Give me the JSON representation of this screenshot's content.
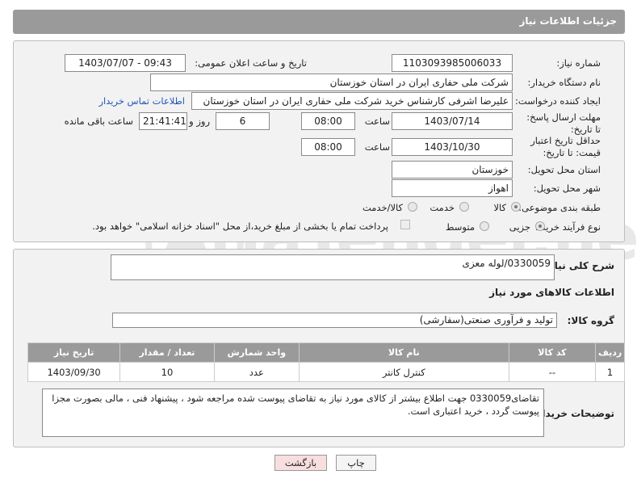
{
  "header": {
    "title": "جزئیات اطلاعات نیاز"
  },
  "form": {
    "need_number_label": "شماره نیاز:",
    "need_number": "1103093985006033",
    "announce_label": "تاریخ و ساعت اعلان عمومی:",
    "announce_value": "1403/07/07 - 09:43",
    "buyer_label": "نام دستگاه خریدار:",
    "buyer_value": "شرکت ملی حفاری ایران در استان خوزستان",
    "creator_label": "ایجاد کننده درخواست:",
    "creator_value": "علیرضا اشرفی کارشناس خرید شرکت ملی حفاری ایران در استان خوزستان",
    "contact_link": "اطلاعات تماس خریدار",
    "deadline_label": "مهلت ارسال پاسخ: تا تاریخ:",
    "deadline_date": "1403/07/14",
    "time_label": "ساعت",
    "deadline_time": "08:00",
    "days_value": "6",
    "days_label": "روز و",
    "remaining_time": "21:41:41",
    "remaining_label": "ساعت باقی مانده",
    "validity_label": "حداقل تاریخ اعتبار قیمت: تا تاریخ:",
    "validity_date": "1403/10/30",
    "validity_time": "08:00",
    "province_label": "استان محل تحویل:",
    "province_value": "خوزستان",
    "city_label": "شهر محل تحویل:",
    "city_value": "اهواز",
    "category_label": "طبقه بندی موضوعی:",
    "category_options": [
      "کالا",
      "خدمت",
      "کالا/خدمت"
    ],
    "category_selected": "کالا",
    "process_label": "نوع فرآیند خرید :",
    "process_options": [
      "جزیی",
      "متوسط"
    ],
    "process_selected": "جزیی",
    "payment_note": "پرداخت تمام یا بخشی از مبلغ خرید،از محل \"اسناد خزانه اسلامی\" خواهد بود."
  },
  "details": {
    "description_label": "شرح کلی نیاز:",
    "description_value": "0330059/لوله معزی",
    "items_title": "اطلاعات کالاهای مورد نیاز",
    "group_label": "گروه کالا:",
    "group_value": "تولید و فرآوری صنعتی(سفارشی)",
    "table_headers": [
      "ردیف",
      "کد کالا",
      "نام کالا",
      "واحد شمارش",
      "تعداد / مقدار",
      "تاریخ نیاز"
    ],
    "rows": [
      {
        "row": "1",
        "code": "--",
        "name": "کنترل کانتر",
        "unit": "عدد",
        "qty": "10",
        "date": "1403/09/30"
      }
    ],
    "buyer_notes_label": "توضیحات خریدار:",
    "buyer_notes_value": "تقاضای0330059 جهت اطلاع بیشتر از کالای مورد نیاز به تقاضای پیوست شده مراجعه شود ، پیشنهاد فنی ، مالی بصورت مجزا پیوست گردد ، خرید اعتباری است."
  },
  "buttons": {
    "print": "چاپ",
    "back": "بازگشت"
  },
  "colors": {
    "header_bg": "#9a9a9a",
    "panel_bg": "#f2f2f2",
    "link": "#2255bb",
    "back_button_bg": "#f8dede"
  }
}
